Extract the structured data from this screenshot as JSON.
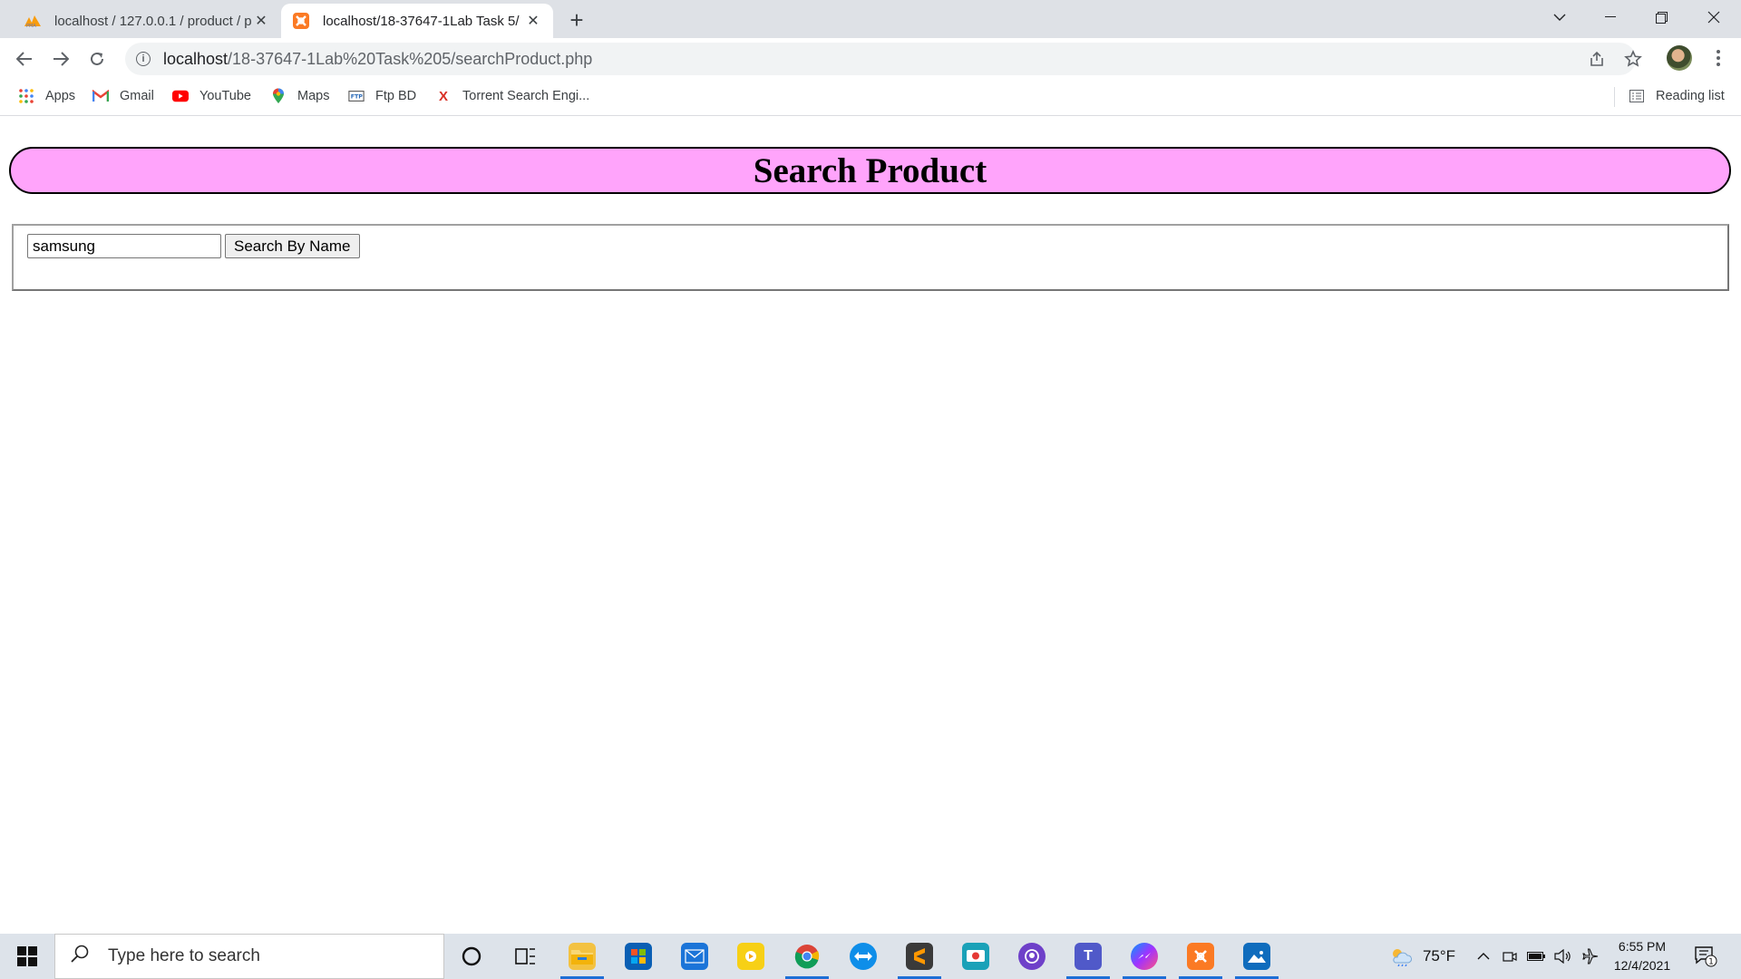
{
  "browser": {
    "tabs": [
      {
        "title": "localhost / 127.0.0.1 / product / p",
        "icon": "phpmyadmin-icon",
        "active": false
      },
      {
        "title": "localhost/18-37647-1Lab Task 5/",
        "icon": "xampp-icon",
        "active": true
      }
    ],
    "address": {
      "host": "localhost",
      "path": "/18-37647-1Lab%20Task%205/searchProduct.php"
    },
    "bookmarks": [
      {
        "label": "Apps",
        "icon": "apps-grid-icon"
      },
      {
        "label": "Gmail",
        "icon": "gmail-icon"
      },
      {
        "label": "YouTube",
        "icon": "youtube-icon"
      },
      {
        "label": "Maps",
        "icon": "maps-icon"
      },
      {
        "label": "Ftp BD",
        "icon": "ftp-icon"
      },
      {
        "label": "Torrent Search Engi...",
        "icon": "torrent-icon"
      }
    ],
    "reading_list": "Reading list"
  },
  "page": {
    "heading": "Search Product",
    "search": {
      "value": "samsung",
      "button_label": "Search By Name"
    },
    "colors": {
      "header_bg": "#ffa4fb"
    }
  },
  "taskbar": {
    "search_placeholder": "Type here to search",
    "weather": "75°F",
    "time": "6:55 PM",
    "date": "12/4/2021",
    "notifications": "1"
  }
}
